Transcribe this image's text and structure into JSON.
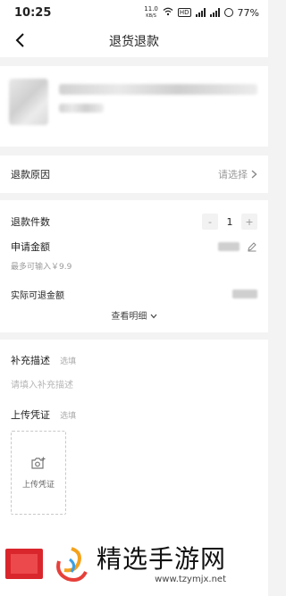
{
  "status_bar": {
    "time": "10:25",
    "speed_top": "11.0",
    "speed_bottom": "KB/S",
    "battery": "77%"
  },
  "header": {
    "title": "退货退款"
  },
  "refund_reason": {
    "label": "退款原因",
    "value": "请选择"
  },
  "refund_quantity": {
    "label": "退款件数",
    "minus": "-",
    "value": "1",
    "plus": "+"
  },
  "apply_amount": {
    "label": "申请金额",
    "hint": "最多可输入￥9.9"
  },
  "actual_amount": {
    "label": "实际可退金额"
  },
  "view_detail": {
    "label": "查看明细"
  },
  "supplement": {
    "label": "补充描述",
    "tag": "选填",
    "placeholder": "请填入补充描述"
  },
  "upload": {
    "label": "上传凭证",
    "tag": "选填",
    "button_label": "上传凭证"
  },
  "watermark": {
    "text": "精选手游网",
    "url": "www.tzymjx.net"
  }
}
